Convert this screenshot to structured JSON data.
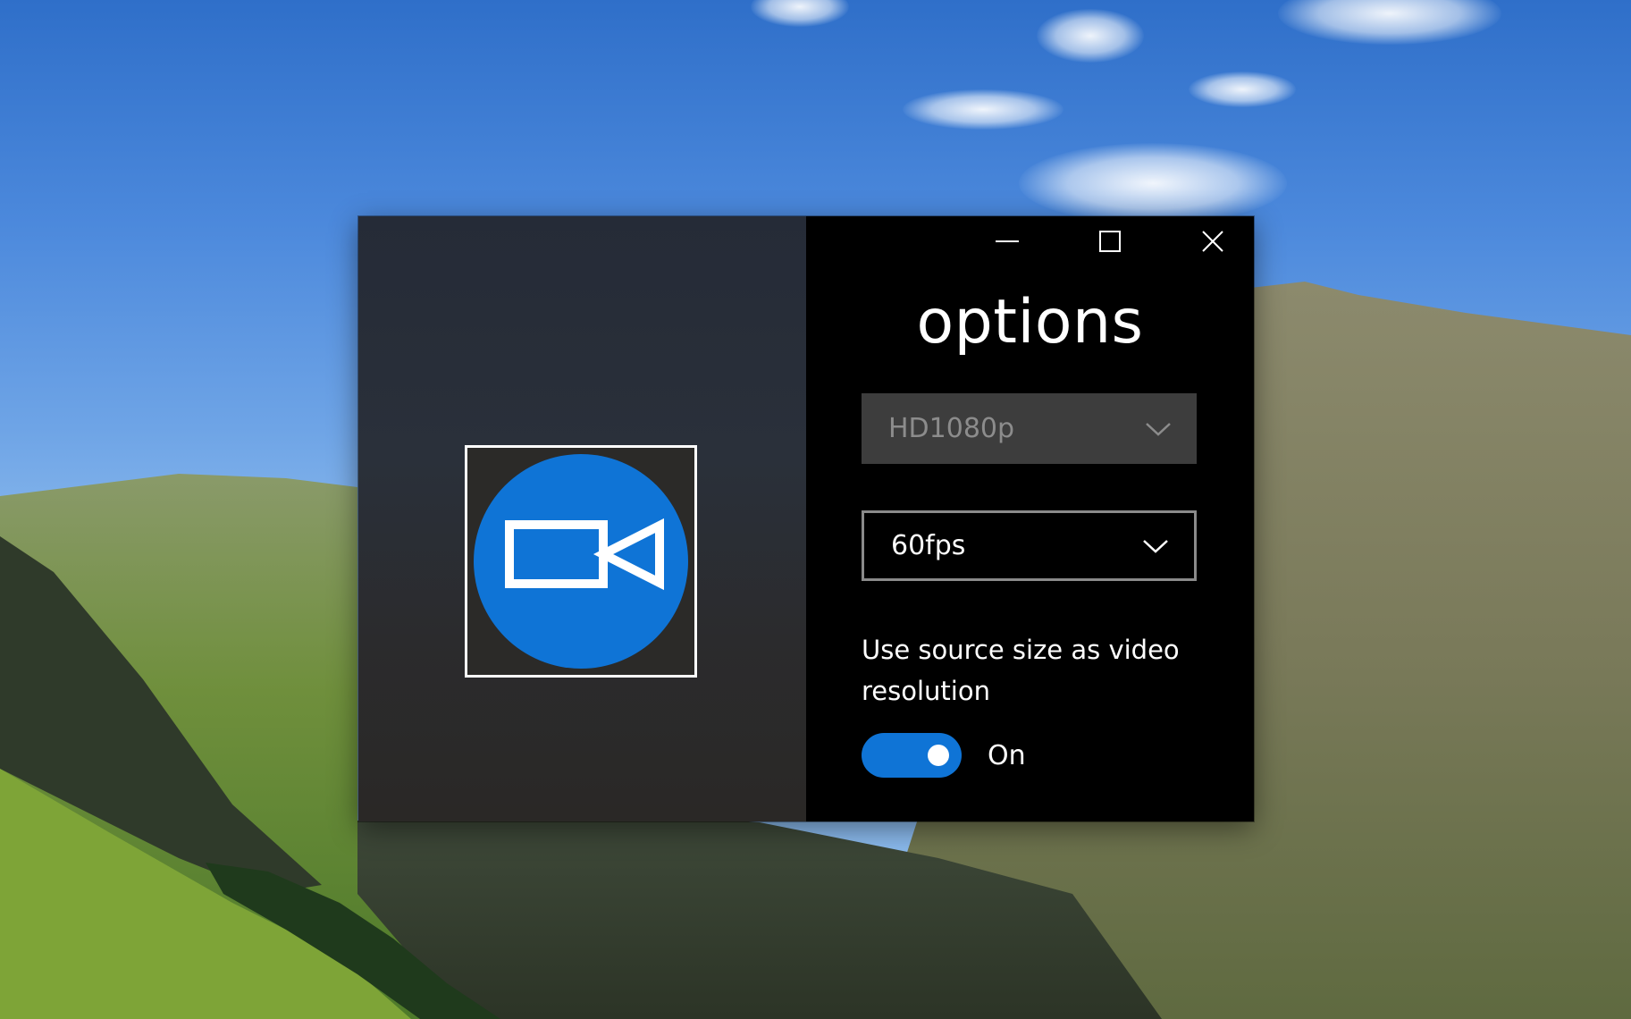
{
  "window": {
    "title": "options",
    "caption_buttons": [
      "minimize",
      "maximize",
      "close"
    ]
  },
  "app_icon": {
    "name": "video-camera-icon",
    "color": "#0f74d6"
  },
  "resolution_dropdown": {
    "value": "HD1080p",
    "enabled": false
  },
  "fps_dropdown": {
    "value": "60fps",
    "enabled": true
  },
  "source_size_toggle": {
    "label": "Use source size as video resolution",
    "state_text": "On",
    "checked": true,
    "accent_color": "#0f74d6"
  }
}
